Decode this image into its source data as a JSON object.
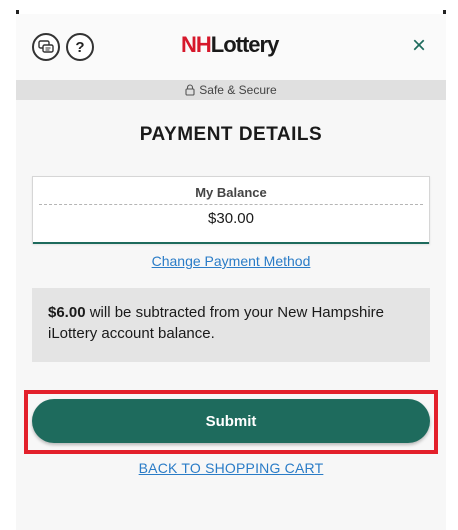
{
  "header": {
    "logo_nh": "NH",
    "logo_lottery": "Lottery",
    "help_glyph": "?",
    "close_glyph": "×"
  },
  "secure": {
    "label": "Safe & Secure"
  },
  "title": "PAYMENT DETAILS",
  "balance": {
    "label": "My Balance",
    "value": "$30.00"
  },
  "change_payment_link": "Change Payment Method",
  "notice": {
    "amount": "$6.00",
    "text": " will be subtracted from your New Hampshire iLottery account balance."
  },
  "submit_label": "Submit",
  "back_link": "BACK TO SHOPPING CART",
  "colors": {
    "accent": "#1e6b5d",
    "link": "#2a7cc7",
    "highlight": "#e3202b",
    "logo_red": "#d6182b"
  },
  "icons": [
    "chat-icon",
    "help-icon",
    "close-icon",
    "lock-icon"
  ]
}
